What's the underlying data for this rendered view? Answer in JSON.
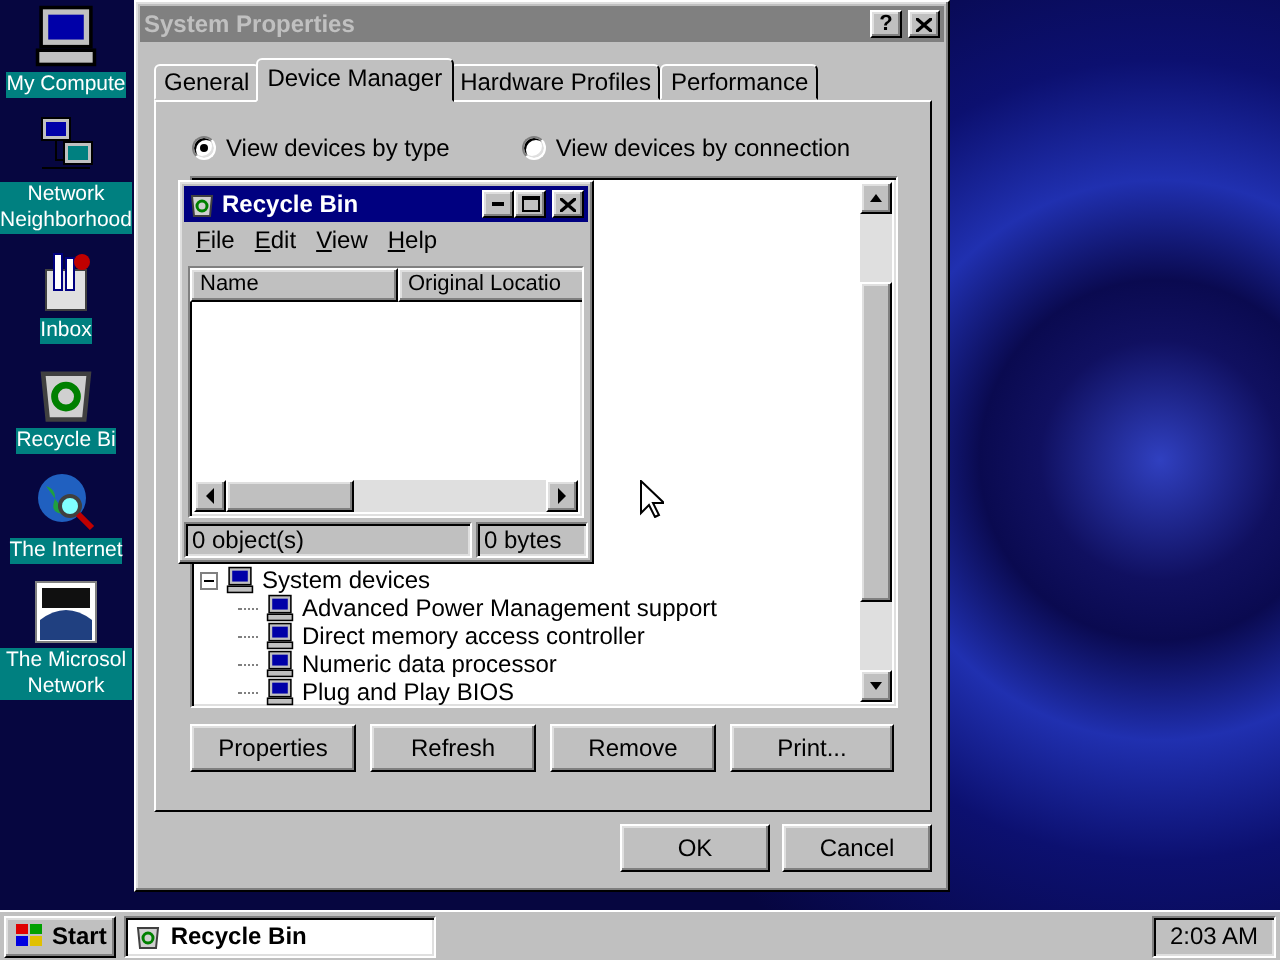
{
  "desktop_icons": [
    {
      "kind": "computer",
      "label": "My Compute"
    },
    {
      "kind": "network",
      "label": "Network Neighborhood"
    },
    {
      "kind": "inbox",
      "label": "Inbox"
    },
    {
      "kind": "recycle",
      "label": "Recycle Bi"
    },
    {
      "kind": "globe",
      "label": "The Internet"
    },
    {
      "kind": "msn",
      "label": "The Microsol Network"
    }
  ],
  "system_properties": {
    "title": "System Properties",
    "active": false,
    "help_button": "?",
    "tabs": [
      {
        "label": "General",
        "selected": false
      },
      {
        "label": "Device Manager",
        "selected": true
      },
      {
        "label": "Hardware Profiles",
        "selected": false
      },
      {
        "label": "Performance",
        "selected": false
      }
    ],
    "view_options": [
      {
        "label": "View devices by type",
        "selected": true
      },
      {
        "label": "View devices by connection",
        "selected": false
      }
    ],
    "device_tree": [
      {
        "label": "System devices",
        "expanded": true,
        "children": [
          {
            "label": "Advanced Power Management support"
          },
          {
            "label": "Direct memory access controller"
          },
          {
            "label": "Numeric data processor"
          },
          {
            "label": "Plug and Play BIOS"
          }
        ]
      }
    ],
    "buttons": [
      "Properties",
      "Refresh",
      "Remove",
      "Print..."
    ],
    "dialog_buttons": [
      "OK",
      "Cancel"
    ]
  },
  "recycle_bin": {
    "title": "Recycle Bin",
    "active": true,
    "menu": [
      "File",
      "Edit",
      "View",
      "Help"
    ],
    "columns": [
      "Name",
      "Original Locatio"
    ],
    "status": [
      "0 object(s)",
      "0 bytes"
    ]
  },
  "taskbar": {
    "start": "Start",
    "tasks": [
      {
        "label": "Recycle Bin",
        "selected": true
      }
    ],
    "clock": "2:03 AM"
  }
}
